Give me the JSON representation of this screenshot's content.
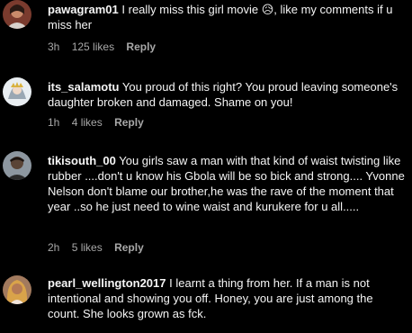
{
  "comments": [
    {
      "username": "pawagram01",
      "text": "I really miss this girl movie 😥, like my comments if u miss her",
      "time": "3h",
      "likes": "125 likes",
      "reply": "Reply"
    },
    {
      "username": "its_salamotu",
      "text": "You proud of this right? You proud leaving someone's daughter broken and damaged. Shame on you!",
      "time": "1h",
      "likes": "4 likes",
      "reply": "Reply"
    },
    {
      "username": "tikisouth_00",
      "text": "You girls saw a man with that kind of waist twisting like rubber ....don't u know his Gbola will be so bick and strong.... Yvonne Nelson don't blame our brother,he was the rave of the moment that year ..so he just need to wine waist and kurukere for u all.....",
      "time": "2h",
      "likes": "5 likes",
      "reply": "Reply"
    },
    {
      "username": "pearl_wellington2017",
      "text": "I learnt a thing from her. If a man is not intentional and showing you off. Honey, you are just among the count. She looks grown as fck."
    }
  ]
}
